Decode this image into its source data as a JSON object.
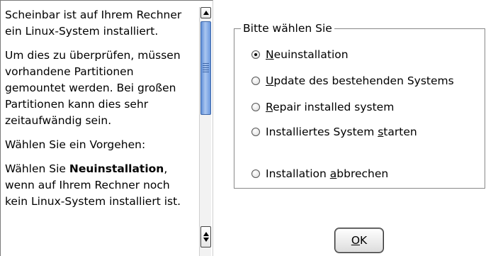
{
  "help": {
    "para1": "Scheinbar ist auf Ihrem Rechner ein Linux-System installiert.",
    "para2": "Um dies zu überprüfen, müssen vorhandene Partitionen gemountet werden. Bei großen Partitionen kann dies sehr zeitaufwändig sein.",
    "para3": "Wählen Sie ein Vorgehen:",
    "para4_prefix": "Wählen Sie ",
    "para4_bold": "Neuinstallation",
    "para4_suffix": ", wenn auf Ihrem Rechner noch kein Linux-System installiert ist."
  },
  "options": {
    "title": "Bitte wählen Sie",
    "items": [
      {
        "mnemonic": "N",
        "rest": "euinstallation",
        "pre": "",
        "checked": true
      },
      {
        "mnemonic": "U",
        "rest": "pdate des bestehenden Systems",
        "pre": "",
        "checked": false
      },
      {
        "mnemonic": "R",
        "rest": "epair installed system",
        "pre": "",
        "checked": false
      },
      {
        "pre": "Installiertes System ",
        "mnemonic": "s",
        "rest": "tarten",
        "checked": false
      },
      {
        "pre": "Installation ",
        "mnemonic": "a",
        "rest": "bbrechen",
        "checked": false
      }
    ],
    "selected": "Neuinstallation"
  },
  "ok_button": {
    "mnemonic": "O",
    "rest": "K"
  },
  "icons": {
    "scroll_up": "arrow-up-icon",
    "scroll_down": "arrow-down-icon"
  }
}
